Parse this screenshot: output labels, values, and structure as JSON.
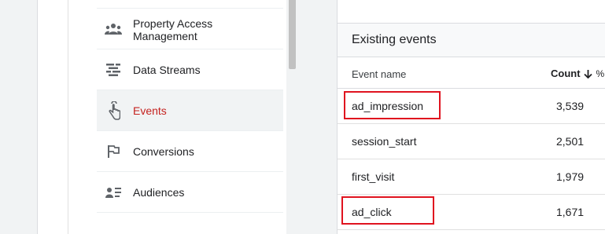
{
  "menu": {
    "items": [
      {
        "label_line1": "Property Access",
        "label_line2": "Management",
        "icon": "people-icon"
      },
      {
        "label": "Data Streams",
        "icon": "data-streams-icon"
      },
      {
        "label": "Events",
        "icon": "touch-icon",
        "selected": true
      },
      {
        "label": "Conversions",
        "icon": "flag-icon"
      },
      {
        "label": "Audiences",
        "icon": "audience-icon"
      }
    ]
  },
  "events": {
    "title": "Existing events",
    "columns": {
      "name": "Event name",
      "count": "Count",
      "percent": "%"
    },
    "rows": [
      {
        "name": "ad_impression",
        "count": "3,539",
        "highlighted": true
      },
      {
        "name": "session_start",
        "count": "2,501",
        "highlighted": false
      },
      {
        "name": "first_visit",
        "count": "1,979",
        "highlighted": false
      },
      {
        "name": "ad_click",
        "count": "1,671",
        "highlighted": true
      }
    ]
  },
  "colors": {
    "selected_text": "#c5221f",
    "highlight": "#e0131f",
    "icon": "#5f6368"
  }
}
